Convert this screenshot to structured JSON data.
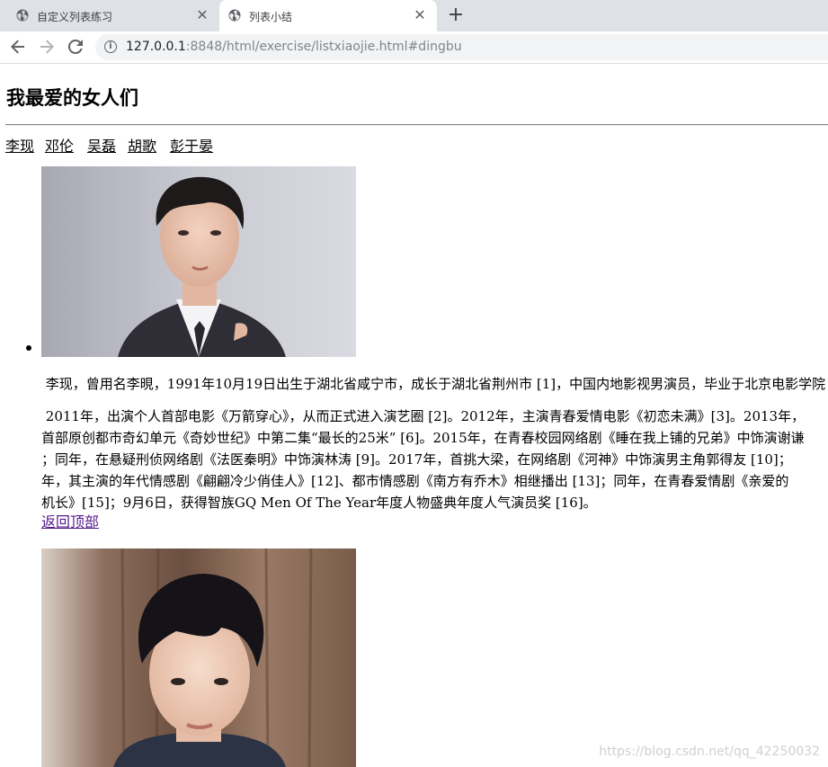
{
  "browser": {
    "tabs": [
      {
        "title": "自定义列表练习",
        "active": false
      },
      {
        "title": "列表小结",
        "active": true
      }
    ],
    "close_glyph": "✕",
    "new_tab_glyph": "+",
    "url_host": "127.0.0.1",
    "url_path": ":8848/html/exercise/listxiaojie.html#dingbu",
    "icons": [
      "globe-icon",
      "close-icon",
      "plus-icon",
      "back-arrow-icon",
      "forward-arrow-icon",
      "reload-icon",
      "info-icon"
    ]
  },
  "page": {
    "title": "我最爱的女人们",
    "nav_links": [
      "李现",
      "邓伦",
      "吴磊",
      "胡歌",
      "彭于晏"
    ],
    "items": [
      {
        "paragraphs": [
          "李现，曾用名李晛，1991年10月19日出生于湖北省咸宁市，成长于湖北省荆州市 [1]，中国内地影视男演员，毕业于北京电影学院",
          "2011年，出演个人首部电影《万箭穿心》，从而正式进入演艺圈 [2]。2012年，主演青春爱情电影《初恋未满》[3]。2013年，",
          "首部原创都市奇幻单元《奇妙世纪》中第二集“最长的25米” [6]。2015年，在青春校园网络剧《睡在我上铺的兄弟》中饰演谢谦",
          "；同年，在悬疑刑侦网络剧《法医秦明》中饰演林涛 [9]。2017年，首挑大梁，在网络剧《河神》中饰演男主角郭得友 [10]；",
          "年，其主演的年代情感剧《翩翩冷少俏佳人》[12]、都市情感剧《南方有乔木》相继播出 [13]；同年，在青春爱情剧《亲爱的",
          "机长》[15]；9月6日，获得智族GQ Men Of The Year年度人物盛典年度人气演员奖 [16]。"
        ],
        "back_to_top": "返回顶部"
      }
    ]
  },
  "watermark": "https://blog.csdn.net/qq_42250032",
  "colors": {
    "tabstrip_bg": "#dee1e6",
    "omnibox_bg": "#f1f3f4",
    "visited_link": "#551a8b"
  }
}
